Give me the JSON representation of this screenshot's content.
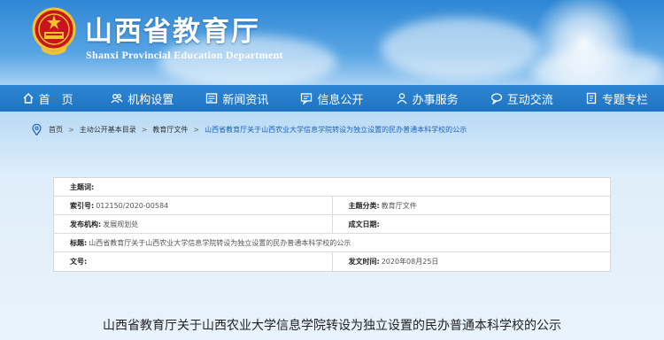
{
  "header": {
    "title": "山西省教育厅",
    "subtitle": "Shanxi Provincial Education Department"
  },
  "nav": [
    {
      "label": "首　页",
      "icon": "home-icon"
    },
    {
      "label": "机构设置",
      "icon": "org-icon"
    },
    {
      "label": "新闻资讯",
      "icon": "news-icon"
    },
    {
      "label": "信息公开",
      "icon": "info-icon"
    },
    {
      "label": "办事服务",
      "icon": "service-icon"
    },
    {
      "label": "互动交流",
      "icon": "chat-icon"
    },
    {
      "label": "专题专栏",
      "icon": "topic-icon"
    }
  ],
  "breadcrumb": {
    "items": [
      "首页",
      "主动公开基本目录",
      "教育厅文件"
    ],
    "current": "山西省教育厅关于山西农业大学信息学院转设为独立设置的民办普通本科学校的公示",
    "separator": ">"
  },
  "info": {
    "subject_label": "主题词:",
    "subject_value": "",
    "index_label": "索引号:",
    "index_value": "012150/2020-00584",
    "category_label": "主题分类:",
    "category_value": "教育厅文件",
    "publisher_label": "发布机构:",
    "publisher_value": "发展规划处",
    "date_label": "成文日期:",
    "date_value": "",
    "title_label": "标题:",
    "title_value": "山西省教育厅关于山西农业大学信息学院转设为独立设置的民办普通本科学校的公示",
    "docno_label": "文号:",
    "docno_value": "",
    "pubdate_label": "发文时间:",
    "pubdate_value": "2020年08月25日"
  },
  "document": {
    "title": "山西省教育厅关于山西农业大学信息学院转设为独立设置的民办普通本科学校的公示"
  },
  "colors": {
    "nav_bg": "#1f74c2",
    "link": "#1c63b7",
    "emblem_red": "#c8151b",
    "emblem_gold": "#f2c230"
  }
}
